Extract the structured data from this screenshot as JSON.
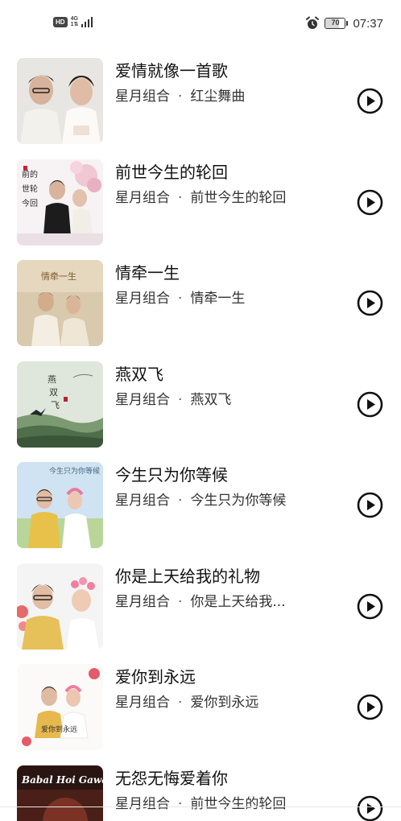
{
  "status_bar": {
    "hd": "HD",
    "net_top": "4G",
    "net_bottom": "1⇅",
    "battery": "70",
    "battery_level": 0.7,
    "time": "07:37"
  },
  "songs": [
    {
      "title": "爱情就像一首歌",
      "artist": "星月组合",
      "separator": "·",
      "album": "红尘舞曲",
      "cover": "cover-couple-studio"
    },
    {
      "title": "前世今生的轮回",
      "artist": "星月组合",
      "separator": "·",
      "album": "前世今生的轮回",
      "cover": "cover-couple-blossom"
    },
    {
      "title": "情牵一生",
      "artist": "星月组合",
      "separator": "·",
      "album": "情牵一生",
      "cover": "cover-couple-sepia"
    },
    {
      "title": "燕双飞",
      "artist": "星月组合",
      "separator": "·",
      "album": "燕双飞",
      "cover": "cover-swallow-landscape"
    },
    {
      "title": "今生只为你等候",
      "artist": "星月组合",
      "separator": "·",
      "album": "今生只为你等候",
      "cover": "cover-couple-sky"
    },
    {
      "title": "你是上天给我的礼物",
      "artist": "星月组合",
      "separator": "·",
      "album": "你是上天给我...",
      "cover": "cover-couple-flowers"
    },
    {
      "title": "爱你到永远",
      "artist": "星月组合",
      "separator": "·",
      "album": "爱你到永远",
      "cover": "cover-couple-white"
    },
    {
      "title": "无怨无悔爱着你",
      "artist": "星月组合",
      "separator": "·",
      "album": "前世今生的轮回",
      "cover": "cover-dark-poster",
      "cover_text": "Babal Hoi Gawa"
    }
  ]
}
